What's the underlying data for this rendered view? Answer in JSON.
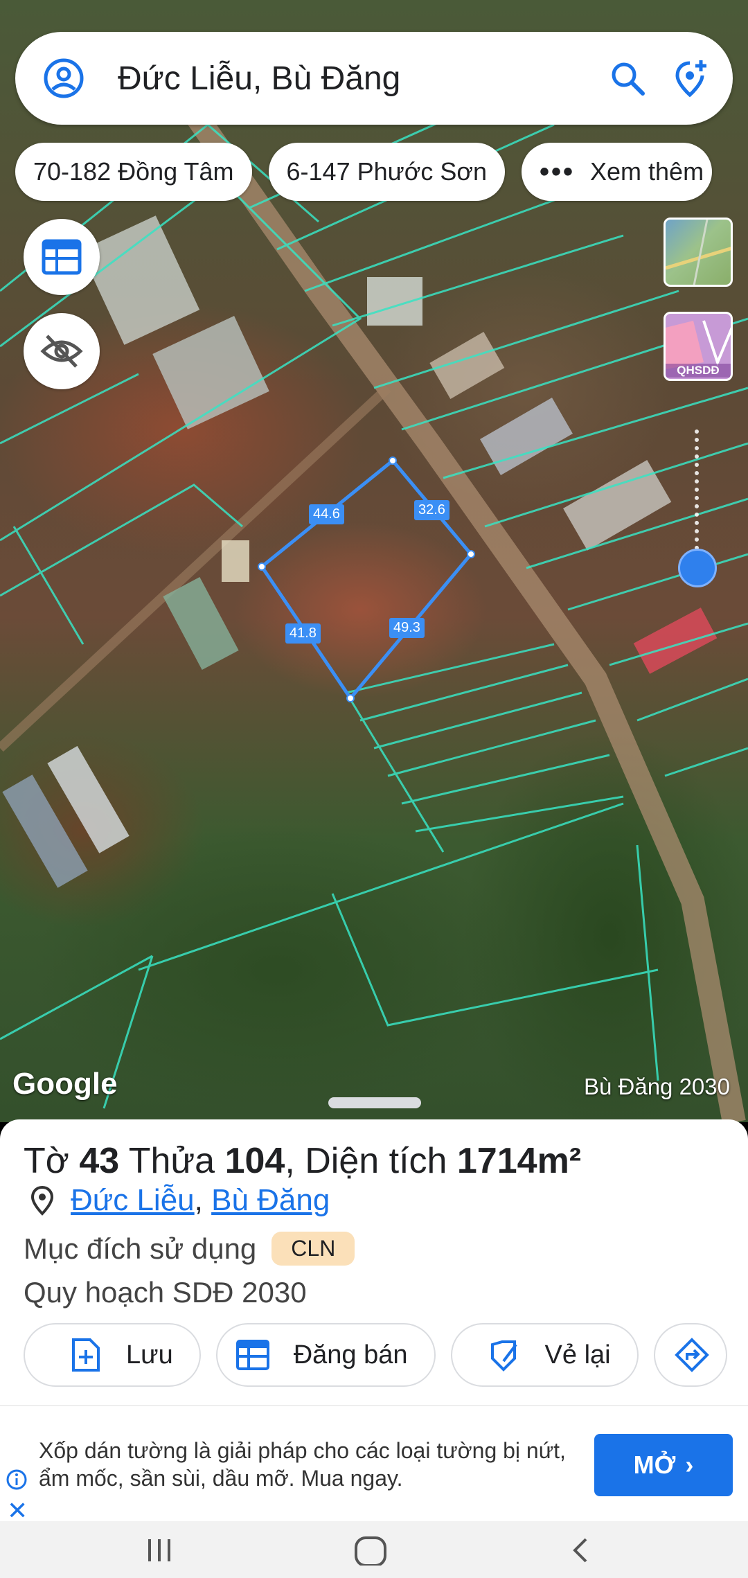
{
  "search": {
    "title": "Đức Liễu, Bù Đăng"
  },
  "chips": [
    {
      "label": "70-182 Đồng Tâm"
    },
    {
      "label": "6-147 Phước Sơn"
    },
    {
      "label": "Xem thêm"
    }
  ],
  "layers": {
    "qhsdd_label": "QHSDĐ"
  },
  "map": {
    "attribution": "Google",
    "plan_label": "Bù Đăng 2030",
    "edge_lengths": [
      "44.6",
      "32.6",
      "41.8",
      "49.3"
    ]
  },
  "parcel": {
    "sheet_prefix": "Tờ",
    "sheet_number": "43",
    "lot_prefix": "Thửa",
    "lot_number": "104",
    "area_prefix": ", Diện tích",
    "area_value": "1714m²",
    "commune": "Đức Liễu",
    "district": "Bù Đăng",
    "purpose_label": "Mục đích sử dụng",
    "purpose_code": "CLN",
    "plan_text": "Quy hoạch SDĐ 2030"
  },
  "actions": {
    "save": "Lưu",
    "post_sale": "Đăng bán",
    "redraw": "Vẻ lại"
  },
  "ad": {
    "text": "Xốp dán tường là giải pháp cho các loại tường bị nứt, ẩm mốc, sần sùi, dầu mỡ. Mua ngay.",
    "open_label": "MỞ",
    "close_label": "✕"
  },
  "colors": {
    "accent": "#1a73e8",
    "parcel": "#3b8ff5",
    "boundary": "#39e3c4"
  }
}
